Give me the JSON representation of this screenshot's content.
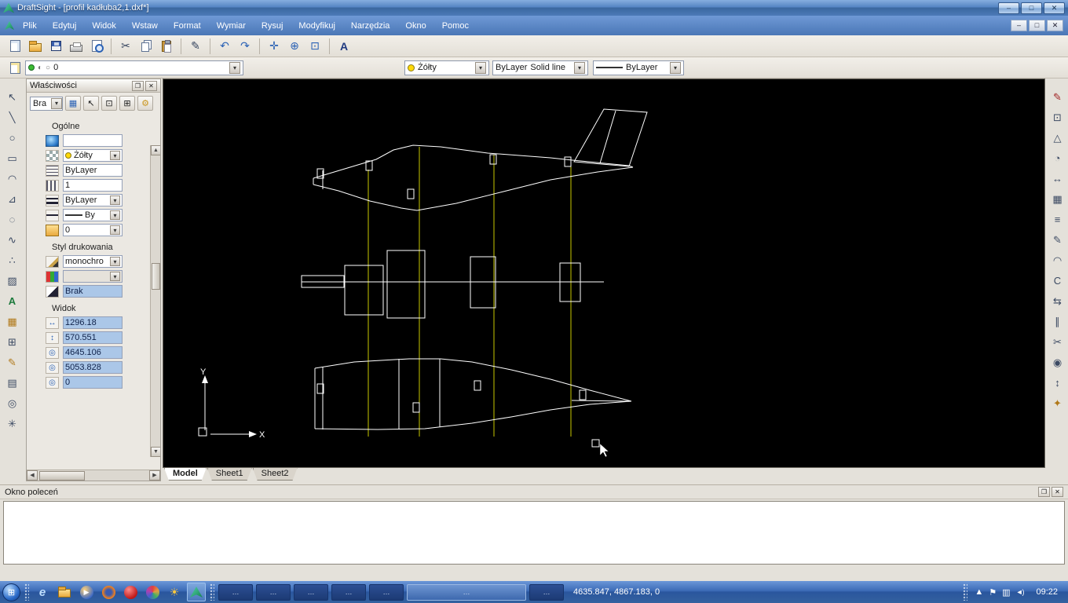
{
  "window": {
    "title": "DraftSight - [profil kadłuba2,1.dxf*]"
  },
  "menu": {
    "items": [
      "Plik",
      "Edytuj",
      "Widok",
      "Wstaw",
      "Format",
      "Wymiar",
      "Rysuj",
      "Modyfikuj",
      "Narzędzia",
      "Okno",
      "Pomoc"
    ]
  },
  "layer_toolbar": {
    "layer": "0"
  },
  "format_toolbar": {
    "color": "Żółty",
    "linestyle": "ByLayer",
    "linestyle2": "Solid line",
    "lineweight": "ByLayer"
  },
  "properties_panel": {
    "title": "Właściwości",
    "filter": "Bra",
    "general": {
      "title": "Ogólne",
      "name": "",
      "color": "Żółty",
      "linestyle": "ByLayer",
      "linescale": "1",
      "lineweight": "ByLayer",
      "linepattern": "By",
      "layer": "0"
    },
    "print": {
      "title": "Styl drukowania",
      "style": "monochro",
      "value": "Brak"
    },
    "view": {
      "title": "Widok",
      "width": "1296.18",
      "height": "570.551",
      "cx": "4645.106",
      "cy": "5053.828",
      "cz": "0"
    }
  },
  "sheet_tabs": {
    "items": [
      "Model",
      "Sheet1",
      "Sheet2"
    ],
    "active": "Model"
  },
  "command_window": {
    "title": "Okno poleceń",
    "content": ""
  },
  "canvas": {
    "x_label": "X",
    "y_label": "Y"
  },
  "taskbar": {
    "clock": "09:22",
    "coords": "4635.847, 4867.183, 0",
    "buttons": [
      "…",
      "…",
      "…",
      "…",
      "…",
      "…",
      "…"
    ]
  },
  "colors": {
    "accent_yellow": "#ffd90a",
    "canvas_bg": "#000000",
    "construction_line": "#c8c800",
    "selection_blue": "#abc7e8"
  },
  "icons": {
    "dropdown": "▾",
    "cut": "✂",
    "brush": "✎",
    "undo": "↶",
    "redo": "↷",
    "pan": "✛",
    "zoom_in": "⊕",
    "zoom_fit": "⊡",
    "annotate": "A",
    "pointer": "↖",
    "line": "╲",
    "circle": "○",
    "rect": "▭",
    "arc": "◠",
    "polyline": "⊿",
    "ellipse": "◌",
    "spline": "∿",
    "point": "∴",
    "hatch": "▨",
    "text": "A",
    "image": "▦",
    "table": "⊞",
    "note": "✎",
    "pattern": "▤",
    "ring": "◎",
    "star": "✳",
    "grid": "▦",
    "gear": "⚙",
    "pencil": "✎",
    "setsquare": "△",
    "protractor": "◔",
    "dim": "↔",
    "list": "≡",
    "letter_c": "C",
    "swap": "⇆",
    "parallel": "∥",
    "target": "◉",
    "updown": "↕",
    "sparkle": "✦",
    "min": "–",
    "max": "□",
    "close": "✕",
    "restore": "❐",
    "width_arrow": "↔",
    "height_arrow": "↕",
    "center_circle": "◎",
    "up": "▲",
    "down": "▼",
    "left": "◀",
    "right": "▶",
    "start": "⊞",
    "ie": "e",
    "play": "▶",
    "sun": "☀",
    "flag": "⚑",
    "monitor": "▥",
    "volume": "◄)",
    "half": "◐"
  }
}
